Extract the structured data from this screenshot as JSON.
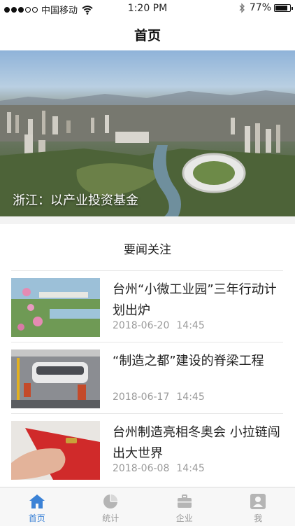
{
  "status_bar": {
    "carrier": "中国移动",
    "time": "1:20 PM",
    "battery_text": "77%",
    "battery_level": 0.77
  },
  "navbar": {
    "title": "首页"
  },
  "banner": {
    "caption": "浙江：以产业投资基金",
    "pages": 5,
    "active_page": 0
  },
  "news": {
    "section_title": "要闻关注",
    "items": [
      {
        "headline": "台州“小微工业园”三年行动计划出炉",
        "date": "2018-06-20",
        "time": "14:45"
      },
      {
        "headline": "“制造之都”建设的脊梁工程",
        "date": "2018-06-17",
        "time": "14:45"
      },
      {
        "headline": "台州制造亮相冬奥会 小拉链闯出大世界",
        "date": "2018-06-08",
        "time": "14:45"
      }
    ]
  },
  "tabbar": {
    "items": [
      {
        "label": "首页",
        "icon": "home-icon",
        "active": true
      },
      {
        "label": "统计",
        "icon": "pie-chart-icon",
        "active": false
      },
      {
        "label": "企业",
        "icon": "briefcase-icon",
        "active": false
      },
      {
        "label": "我",
        "icon": "user-icon",
        "active": false
      }
    ]
  },
  "colors": {
    "accent": "#3b82d6",
    "inactive": "#9a9a9a"
  }
}
